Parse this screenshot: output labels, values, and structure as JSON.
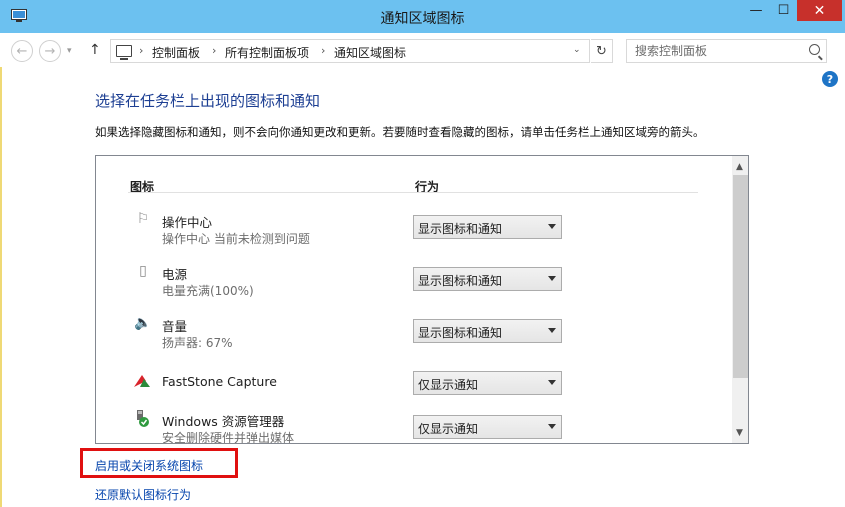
{
  "window": {
    "title": "通知区域图标",
    "minimize_glyph": "—",
    "maximize_glyph": "☐",
    "close_glyph": "✕"
  },
  "nav": {
    "back_glyph": "←",
    "forward_glyph": "→",
    "recent_glyph": "▾",
    "up_glyph": "↑",
    "breadcrumbs": [
      "控制面板",
      "所有控制面板项",
      "通知区域图标"
    ],
    "separator": "›",
    "dropdown_glyph": "⌄",
    "refresh_glyph": "↻",
    "search_placeholder": "搜索控制面板"
  },
  "help_glyph": "?",
  "content": {
    "heading": "选择在任务栏上出现的图标和通知",
    "description": "如果选择隐藏图标和通知，则不会向你通知更改和更新。若要随时查看隐藏的图标，请单击任务栏上通知区域旁的箭头。",
    "columns": {
      "icon": "图标",
      "behavior": "行为"
    },
    "rows": [
      {
        "icon": "flag-icon",
        "glyph": "⚐",
        "name": "操作中心",
        "status": "操作中心  当前未检测到问题",
        "behavior": "显示图标和通知"
      },
      {
        "icon": "battery-icon",
        "glyph": "▯",
        "name": "电源",
        "status": "电量充满(100%)",
        "behavior": "显示图标和通知"
      },
      {
        "icon": "speaker-icon",
        "glyph": "🔈",
        "name": "音量",
        "status": "扬声器: 67%",
        "behavior": "显示图标和通知"
      },
      {
        "icon": "faststone-capture-icon",
        "glyph": "",
        "name": "FastStone Capture",
        "status": "",
        "behavior": "仅显示通知"
      },
      {
        "icon": "safely-remove-hardware-icon",
        "glyph": "",
        "name": "Windows 资源管理器",
        "status": "安全删除硬件并弹出媒体",
        "behavior": "仅显示通知"
      }
    ],
    "scroll_up_glyph": "▲",
    "scroll_down_glyph": "▼"
  },
  "links": {
    "system_icons": "启用或关闭系统图标",
    "restore_default": "还原默认图标行为"
  },
  "colors": {
    "titlebar": "#6cc1f0",
    "heading": "#1d3f93",
    "link": "#0645ad",
    "highlight": "#e01010"
  }
}
